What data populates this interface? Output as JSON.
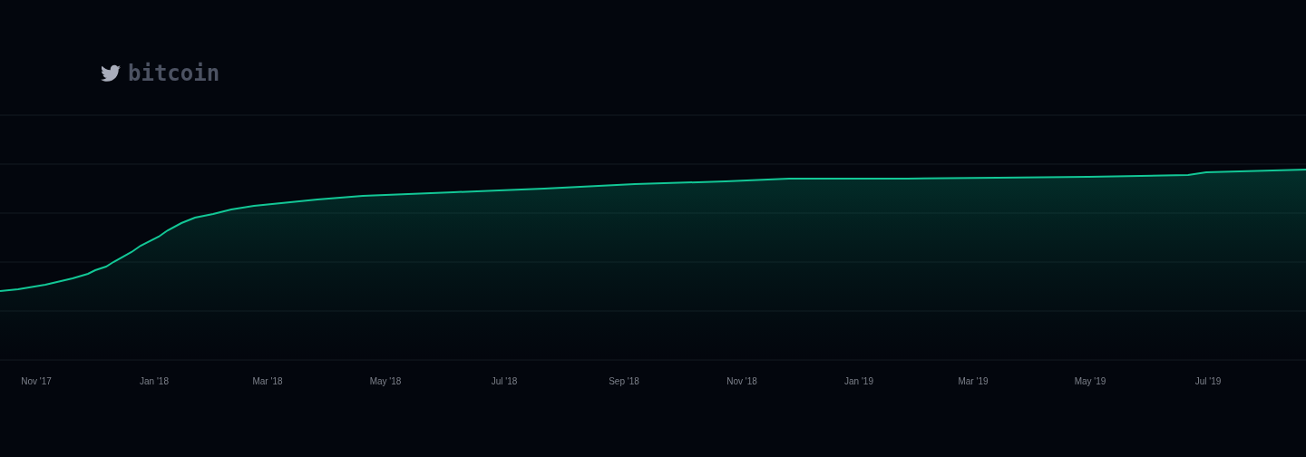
{
  "header": {
    "title": "bitcoin"
  },
  "chart": {
    "kind": "picture",
    "x_axis_labels": [
      "Nov '17",
      "Jan '18",
      "Mar '18",
      "May '18",
      "Jul '18",
      "Sep '18",
      "Nov '18",
      "Jan '19",
      "Mar '19",
      "May '19",
      "Jul '19"
    ]
  }
}
